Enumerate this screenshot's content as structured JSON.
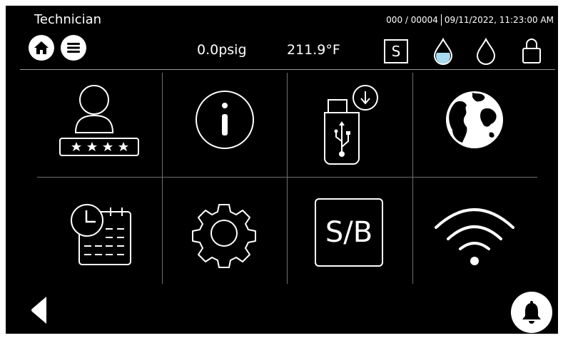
{
  "header": {
    "user_label": "Technician",
    "counter": "000 / 00004",
    "datetime": "09/11/2022, 11:23:00 AM",
    "pressure": "0.0psig",
    "temperature": "211.9°F",
    "mode_badge": "S"
  },
  "status_icons": [
    "water-drop-filled-icon",
    "water-drop-outline-icon",
    "lock-icon"
  ],
  "menu_tiles": [
    {
      "icon": "user-password-icon"
    },
    {
      "icon": "info-icon"
    },
    {
      "icon": "usb-download-icon"
    },
    {
      "icon": "globe-icon"
    },
    {
      "icon": "calendar-clock-icon"
    },
    {
      "icon": "gear-icon"
    },
    {
      "icon": "standby-icon",
      "label": "S/B"
    },
    {
      "icon": "wifi-icon"
    }
  ],
  "footer": {
    "back": "back-arrow-icon",
    "alarm": "bell-icon"
  }
}
